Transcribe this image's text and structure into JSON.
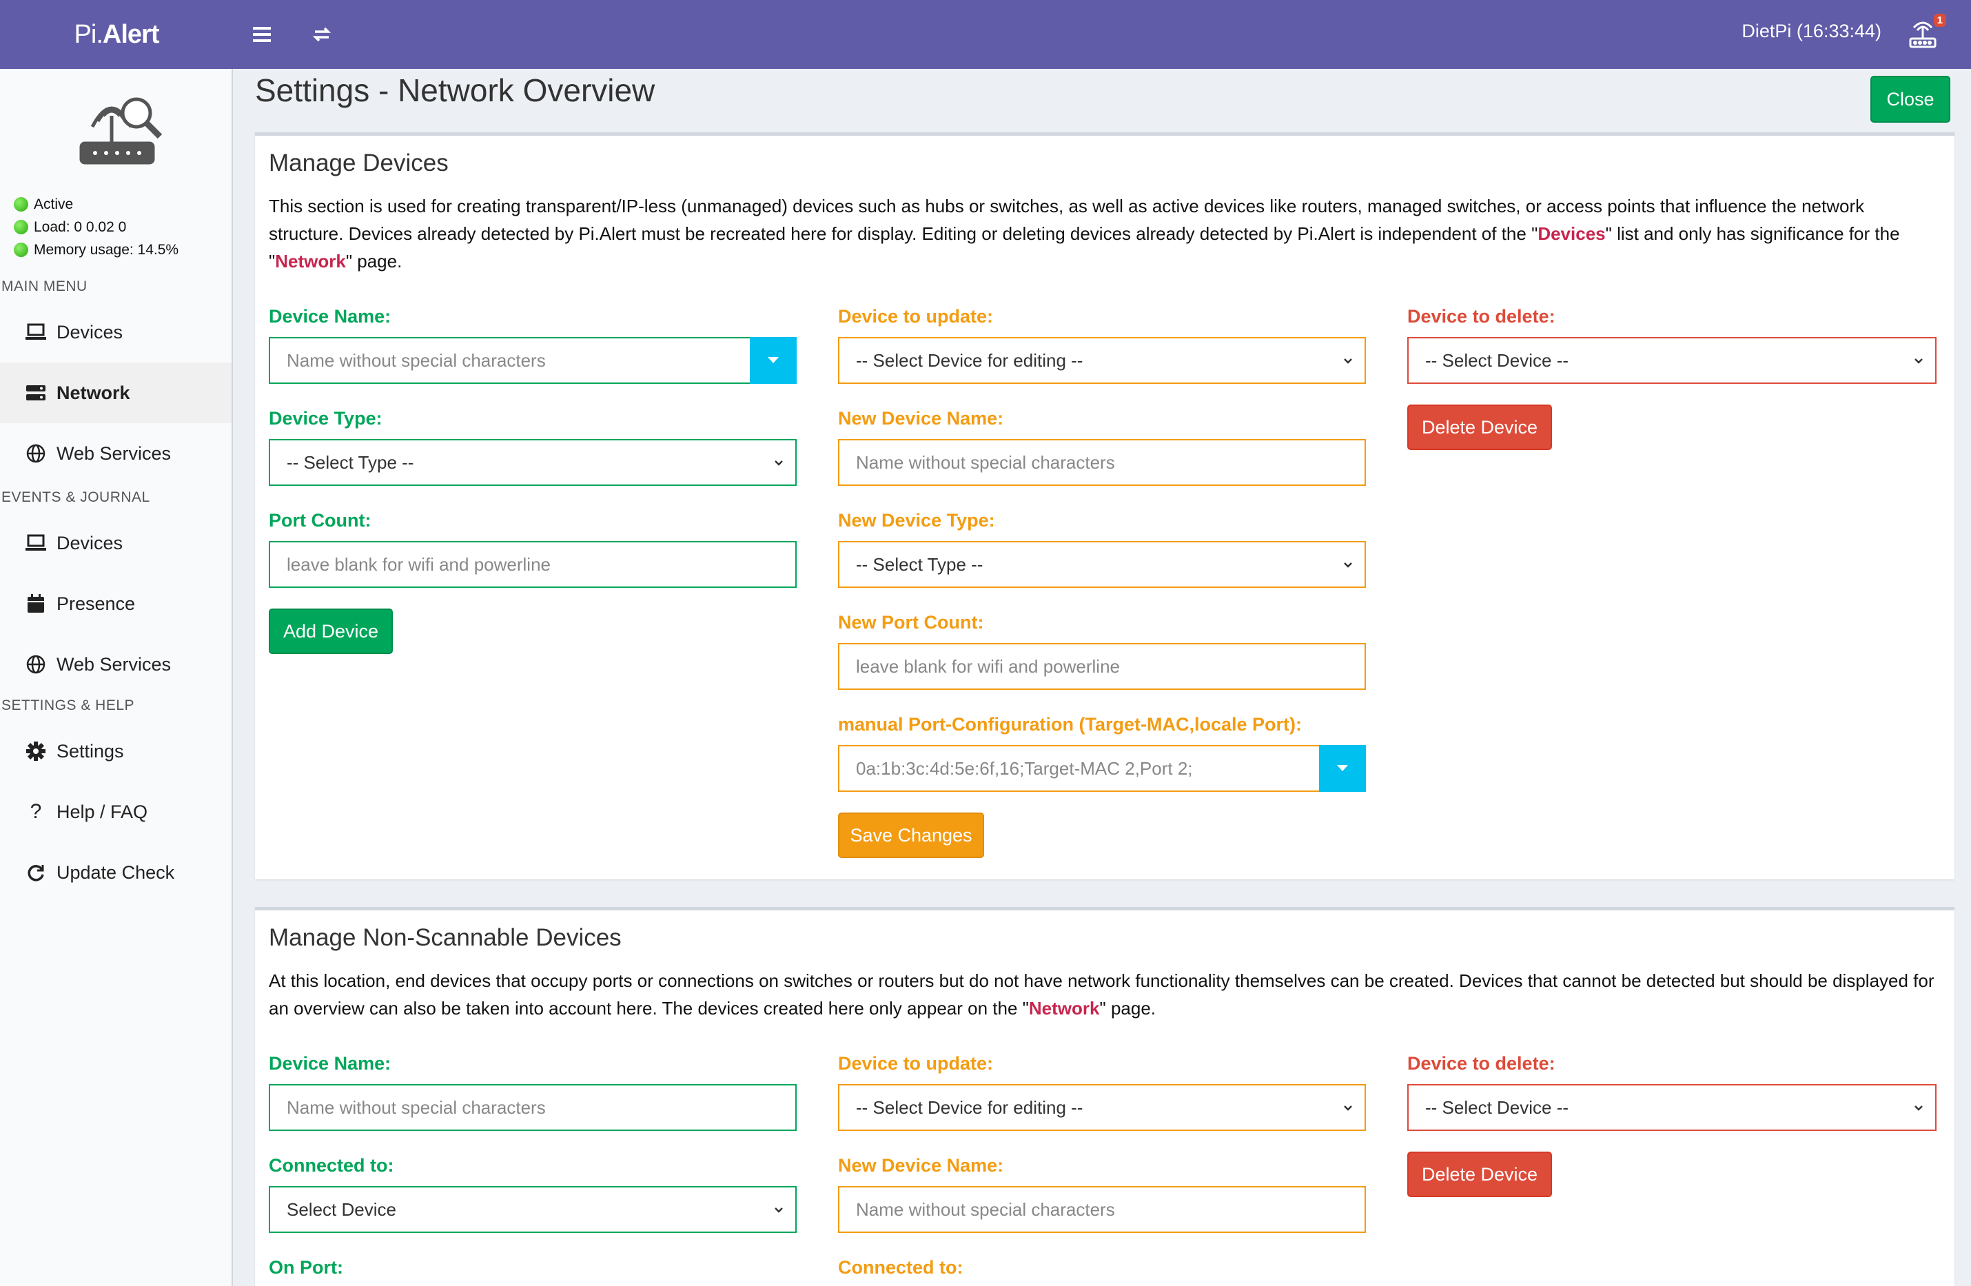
{
  "header": {
    "logo_prefix": "Pi.",
    "logo_suffix": "Alert",
    "clock": "DietPi (16:33:44)",
    "notification_count": "1"
  },
  "sidebar": {
    "status": {
      "active": "Active",
      "load": "Load:  0  0.02  0",
      "memory": "Memory usage:  14.5%"
    },
    "main_menu_header": "MAIN MENU",
    "main_items": [
      {
        "label": "Devices",
        "icon": "laptop-icon"
      },
      {
        "label": "Network",
        "icon": "server-icon"
      },
      {
        "label": "Web Services",
        "icon": "globe-icon"
      }
    ],
    "events_header": "EVENTS & JOURNAL",
    "events_items": [
      {
        "label": "Devices",
        "icon": "laptop-icon"
      },
      {
        "label": "Presence",
        "icon": "calendar-icon"
      },
      {
        "label": "Web Services",
        "icon": "globe-icon"
      }
    ],
    "settings_header": "SETTINGS & HELP",
    "settings_items": [
      {
        "label": "Settings",
        "icon": "gear-icon"
      },
      {
        "label": "Help / FAQ",
        "icon": "question-icon"
      },
      {
        "label": "Update Check",
        "icon": "refresh-icon"
      }
    ]
  },
  "page": {
    "title": "Settings - Network Overview",
    "close_label": "Close"
  },
  "manage": {
    "title": "Manage Devices",
    "desc_1": "This section is used for creating transparent/IP-less (unmanaged) devices such as hubs or switches, as well as active devices like routers, managed switches, or access points that influence the network structure. Devices already detected by Pi.Alert must be recreated here for display. Editing or deleting devices already detected by Pi.Alert is independent of the \"",
    "desc_devices": "Devices",
    "desc_2": "\" list and only has significance for the \"",
    "desc_network": "Network",
    "desc_3": "\" page.",
    "device_name_label": "Device Name:",
    "device_name_placeholder": "Name without special characters",
    "device_type_label": "Device Type:",
    "device_type_value": "-- Select Type --",
    "port_count_label": "Port Count:",
    "port_count_placeholder": "leave blank for wifi and powerline",
    "add_device_label": "Add Device",
    "update_label": "Device to update:",
    "update_value": "-- Select Device for editing --",
    "new_name_label": "New Device Name:",
    "new_name_placeholder": "Name without special characters",
    "new_type_label": "New Device Type:",
    "new_type_value": "-- Select Type --",
    "new_port_label": "New Port Count:",
    "new_port_placeholder": "leave blank for wifi and powerline",
    "manual_port_label": "manual Port-Configuration (Target-MAC,locale Port):",
    "manual_port_placeholder": "0a:1b:3c:4d:5e:6f,16;Target-MAC 2,Port 2;",
    "save_label": "Save Changes",
    "delete_label": "Device to delete:",
    "delete_value": "-- Select Device --",
    "delete_button": "Delete Device"
  },
  "nonscan": {
    "title": "Manage Non-Scannable Devices",
    "desc_1": "At this location, end devices that occupy ports or connections on switches or routers but do not have network functionality themselves can be created. Devices that cannot be detected but should be displayed for an overview can also be taken into account here. The devices created here only appear on the \"",
    "desc_network": "Network",
    "desc_2": "\" page.",
    "device_name_label": "Device Name:",
    "device_name_placeholder": "Name without special characters",
    "connected_label": "Connected to:",
    "connected_value": "Select Device",
    "on_port_label": "On Port:",
    "update_label": "Device to update:",
    "update_value": "-- Select Device for editing --",
    "new_name_label": "New Device Name:",
    "new_name_placeholder": "Name without special characters",
    "connected2_label": "Connected to:",
    "delete_label": "Device to delete:",
    "delete_value": "-- Select Device --",
    "delete_button": "Delete Device"
  },
  "colors": {
    "header": "#605ca8",
    "green": "#00a65a",
    "orange": "#f39c12",
    "red": "#dd4b39",
    "cyan": "#00c0ef"
  }
}
